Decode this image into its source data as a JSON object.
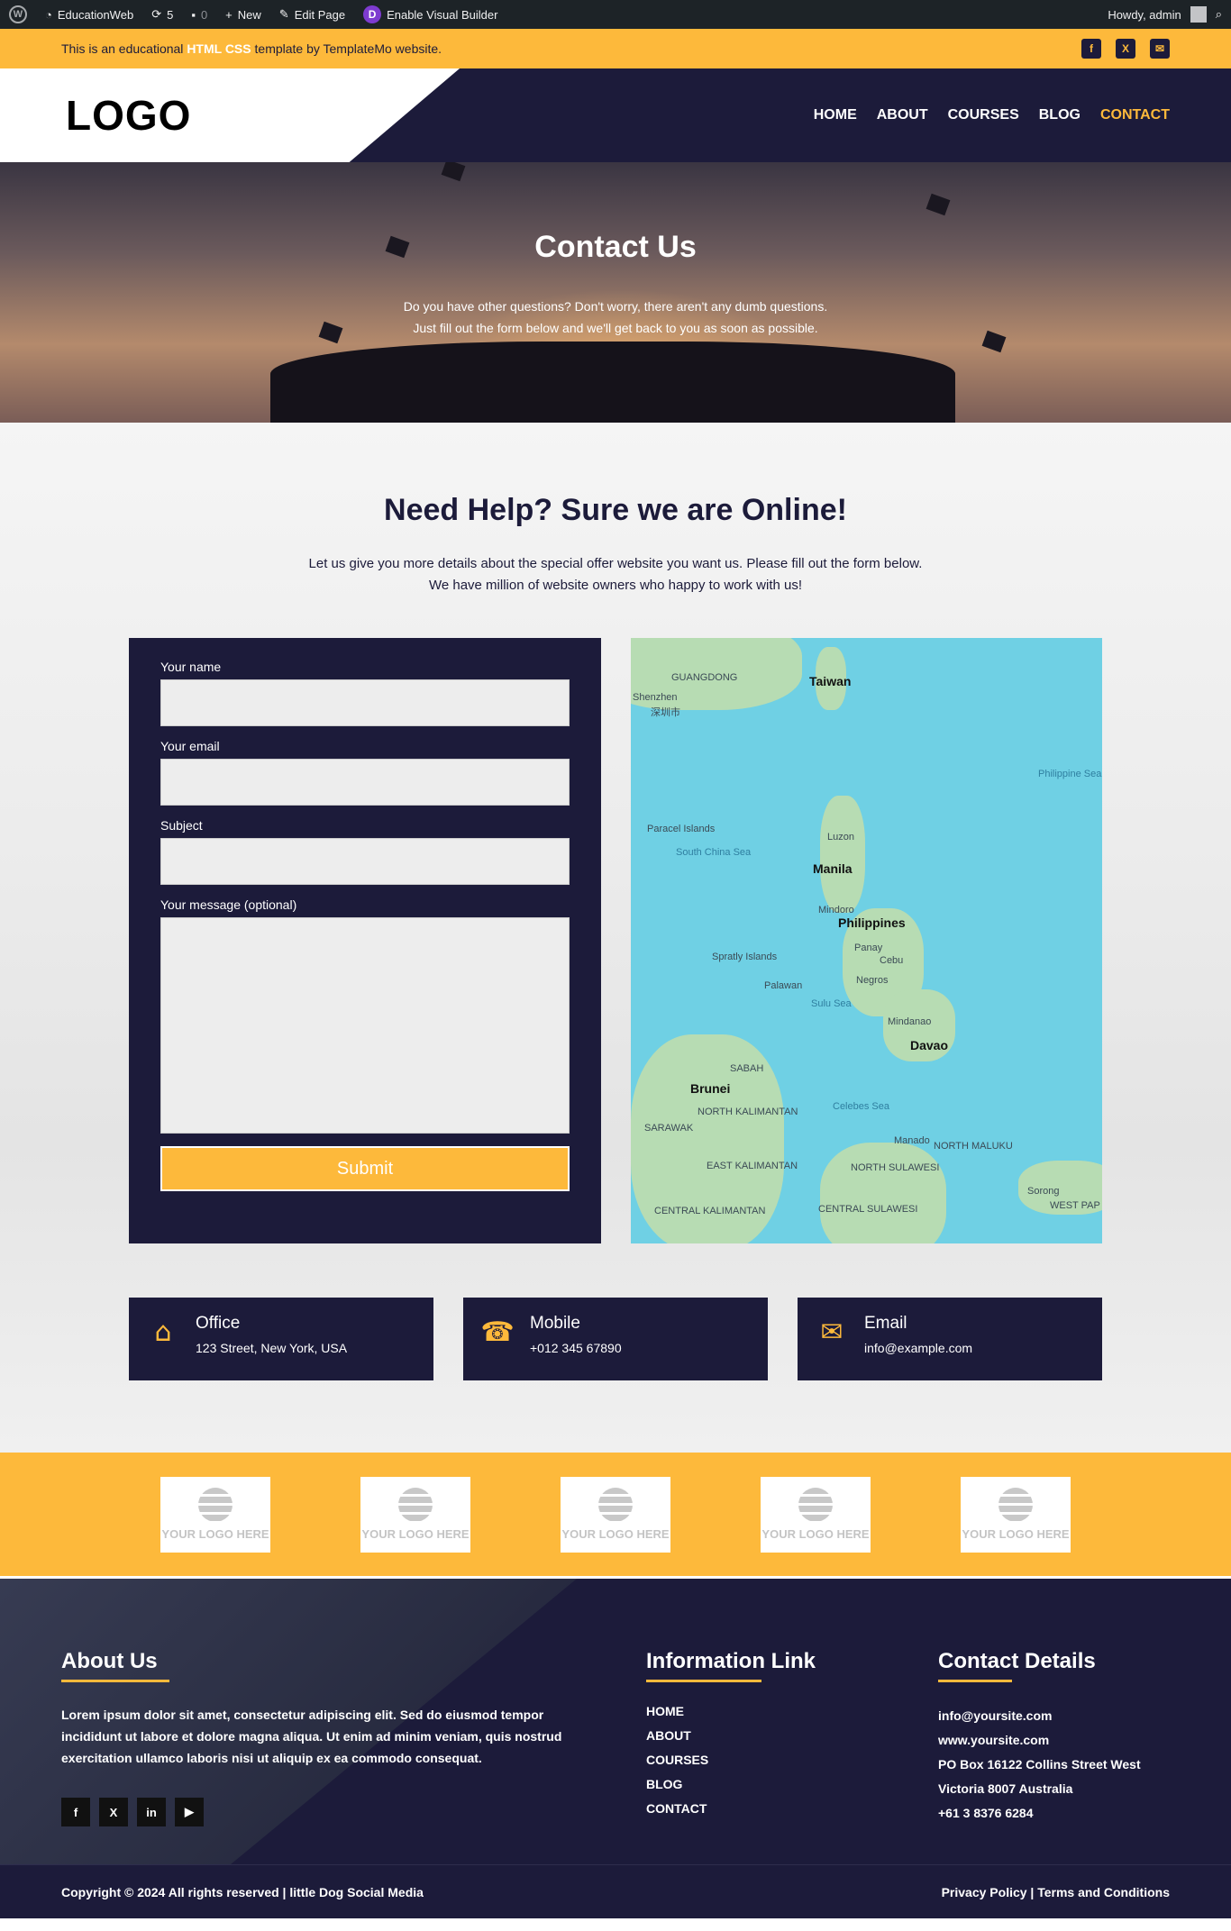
{
  "adminbar": {
    "site": "EducationWeb",
    "updates": "5",
    "comments": "0",
    "new": "New",
    "edit": "Edit Page",
    "visual": "Enable Visual Builder",
    "greeting": "Howdy, admin"
  },
  "topbar": {
    "text_before": "This is an educational ",
    "highlight": "HTML CSS",
    "text_after": " template by TemplateMo website."
  },
  "header": {
    "logo": "LOGO",
    "nav": [
      "HOME",
      "ABOUT",
      "COURSES",
      "BLOG",
      "CONTACT"
    ]
  },
  "hero": {
    "title": "Contact Us",
    "line1": "Do you have other questions? Don't worry, there aren't any dumb questions.",
    "line2": "Just fill out the form below and we'll get back to you as soon as possible."
  },
  "main": {
    "title": "Need Help? Sure we are Online!",
    "line1": "Let us give you more details about the special offer website you want us. Please fill out the form below.",
    "line2": "We have million of website owners who happy to work with us!"
  },
  "form": {
    "name_label": "Your name",
    "email_label": "Your email",
    "subject_label": "Subject",
    "message_label": "Your message (optional)",
    "submit": "Submit"
  },
  "map": {
    "labels": [
      "GUANGDONG",
      "Shenzhen",
      "深圳市",
      "Taiwan",
      "Philippine Sea",
      "Paracel Islands",
      "South China Sea",
      "Luzon",
      "Manila",
      "Mindoro",
      "Philippines",
      "Panay",
      "Cebu",
      "Negros",
      "Spratly Islands",
      "Palawan",
      "Sulu Sea",
      "Mindanao",
      "Davao",
      "SABAH",
      "Brunei",
      "NORTH KALIMANTAN",
      "SARAWAK",
      "Celebes Sea",
      "Manado",
      "NORTH MALUKU",
      "NORTH SULAWESI",
      "EAST KALIMANTAN",
      "CENTRAL KALIMANTAN",
      "CENTRAL SULAWESI",
      "Sorong",
      "WEST PAP"
    ]
  },
  "contact_cards": [
    {
      "title": "Office",
      "value": "123 Street, New York, USA",
      "icon": "house-icon"
    },
    {
      "title": "Mobile",
      "value": "+012 345 67890",
      "icon": "phone-icon"
    },
    {
      "title": "Email",
      "value": "info@example.com",
      "icon": "envelope-icon"
    }
  ],
  "partners": {
    "logo_text": "YOUR LOGO HERE"
  },
  "footer": {
    "about_title": "About Us",
    "about_text": "Lorem ipsum dolor sit amet, consectetur adipiscing elit. Sed do eiusmod tempor incididunt ut labore et dolore magna aliqua. Ut enim ad minim veniam, quis nostrud exercitation ullamco laboris nisi ut aliquip ex ea commodo consequat.",
    "links_title": "Information Link",
    "links": [
      "HOME",
      "ABOUT",
      "COURSES",
      "BLOG",
      "CONTACT"
    ],
    "contact_title": "Contact Details",
    "contact_lines": [
      "info@yoursite.com",
      "www.yoursite.com",
      "PO Box 16122 Collins Street West",
      "Victoria 8007 Australia",
      "+61 3 8376 6284"
    ],
    "copyright": "Copyright © 2024 All rights reserved | little Dog Social Media",
    "policy": "Privacy Policy | Terms and Conditions"
  },
  "colors": {
    "accent": "#fdb93b",
    "navy": "#1c1b3a"
  }
}
